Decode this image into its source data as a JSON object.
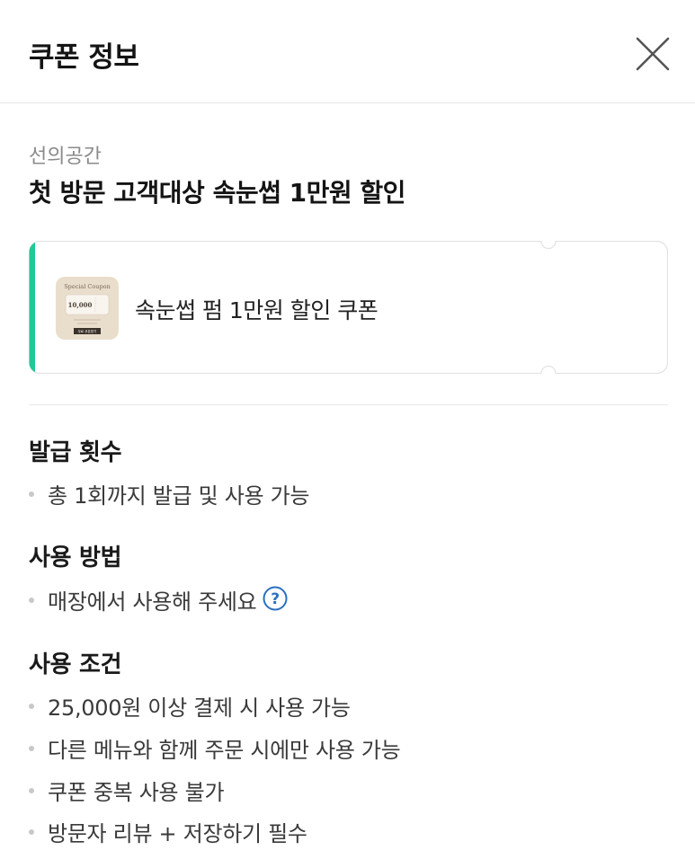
{
  "header": {
    "title": "쿠폰 정보",
    "close_icon": "close-icon"
  },
  "coupon": {
    "store_name": "선의공간",
    "title": "첫 방문 고객대상 속눈썹 1만원 할인",
    "card_name": "속눈썹 펌 1만원 할인 쿠폰",
    "accent_color": "#20c997",
    "thumbnail": {
      "top_text": "Special Coupon",
      "amount": "10,000",
      "button_text": "무료 쿠폰받기"
    }
  },
  "sections": {
    "issue_count": {
      "title": "발급 횟수",
      "items": [
        "총 1회까지 발급 및 사용 가능"
      ]
    },
    "usage_method": {
      "title": "사용 방법",
      "items": [
        "매장에서 사용해 주세요"
      ],
      "help_icon": "question-circle-icon"
    },
    "usage_conditions": {
      "title": "사용 조건",
      "items": [
        "25,000원 이상 결제 시 사용 가능",
        "다른 메뉴와 함께 주문 시에만 사용 가능",
        "쿠폰 중복 사용 불가",
        "방문자 리뷰 + 저장하기 필수"
      ]
    }
  }
}
